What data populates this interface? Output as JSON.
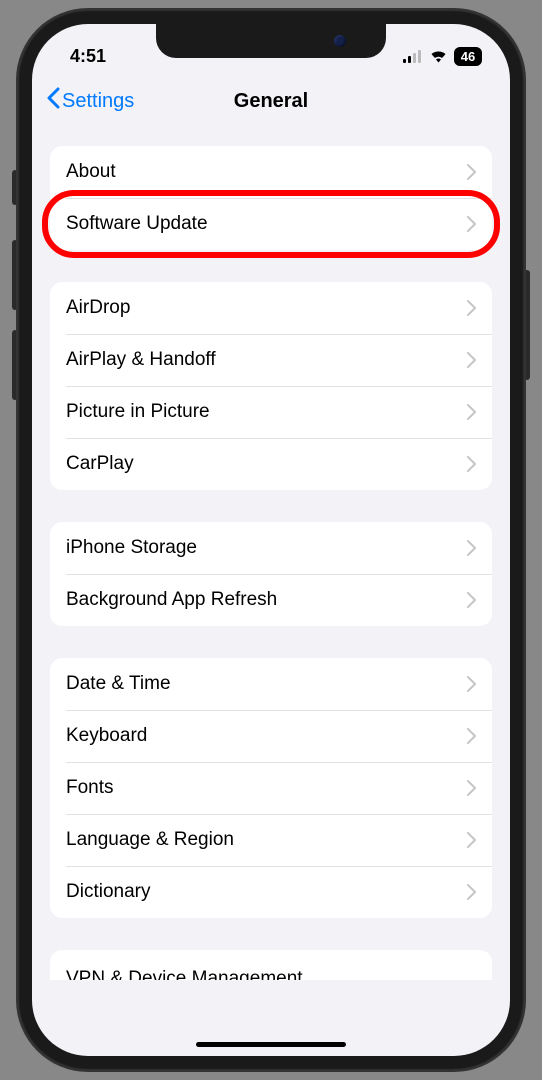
{
  "status": {
    "time": "4:51",
    "battery": "46"
  },
  "nav": {
    "back_label": "Settings",
    "title": "General"
  },
  "groups": [
    {
      "items": [
        {
          "id": "about",
          "label": "About"
        },
        {
          "id": "software-update",
          "label": "Software Update",
          "highlighted": true
        }
      ]
    },
    {
      "items": [
        {
          "id": "airdrop",
          "label": "AirDrop"
        },
        {
          "id": "airplay-handoff",
          "label": "AirPlay & Handoff"
        },
        {
          "id": "picture-in-picture",
          "label": "Picture in Picture"
        },
        {
          "id": "carplay",
          "label": "CarPlay"
        }
      ]
    },
    {
      "items": [
        {
          "id": "iphone-storage",
          "label": "iPhone Storage"
        },
        {
          "id": "background-app-refresh",
          "label": "Background App Refresh"
        }
      ]
    },
    {
      "items": [
        {
          "id": "date-time",
          "label": "Date & Time"
        },
        {
          "id": "keyboard",
          "label": "Keyboard"
        },
        {
          "id": "fonts",
          "label": "Fonts"
        },
        {
          "id": "language-region",
          "label": "Language & Region"
        },
        {
          "id": "dictionary",
          "label": "Dictionary"
        }
      ]
    }
  ],
  "partial_row": {
    "id": "vpn-device-management",
    "label": "VPN & Device Management"
  }
}
